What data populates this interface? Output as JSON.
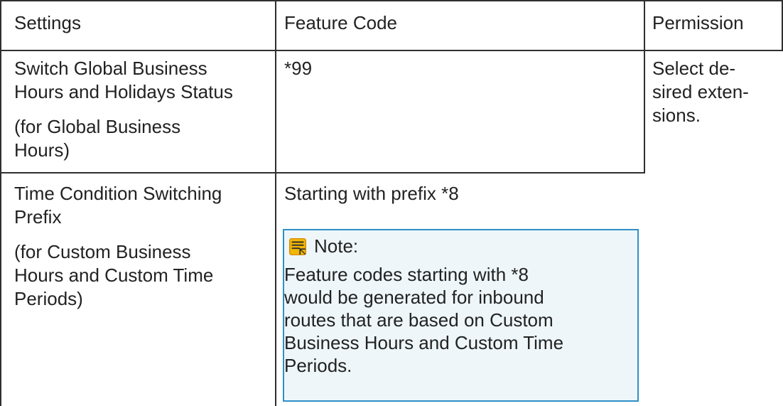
{
  "table": {
    "headers": [
      "Settings",
      "Feature Code",
      "Permission"
    ],
    "rows": [
      {
        "settings_title": "Switch Global Business\nHours and Holidays Status",
        "settings_sub": "(for Global Business\nHours)",
        "feature_code": "*99",
        "permission": "Select de-\nsired exten-\nsions."
      },
      {
        "settings_title": "Time Condition Switching\nPrefix",
        "settings_sub": "(for Custom Business\nHours and Custom Time\nPeriods)",
        "feature_code": "Starting with prefix *8",
        "note": {
          "icon": "note-icon",
          "title": "Note:",
          "text": "Feature codes starting with *8\nwould be generated for inbound\nroutes that are based on Custom\nBusiness Hours and Custom Time\nPeriods."
        }
      }
    ]
  },
  "colors": {
    "border": "#2f2f2f",
    "note_background": "#eef6fa",
    "note_border": "#2f90c6",
    "note_icon": "#f2b705"
  }
}
